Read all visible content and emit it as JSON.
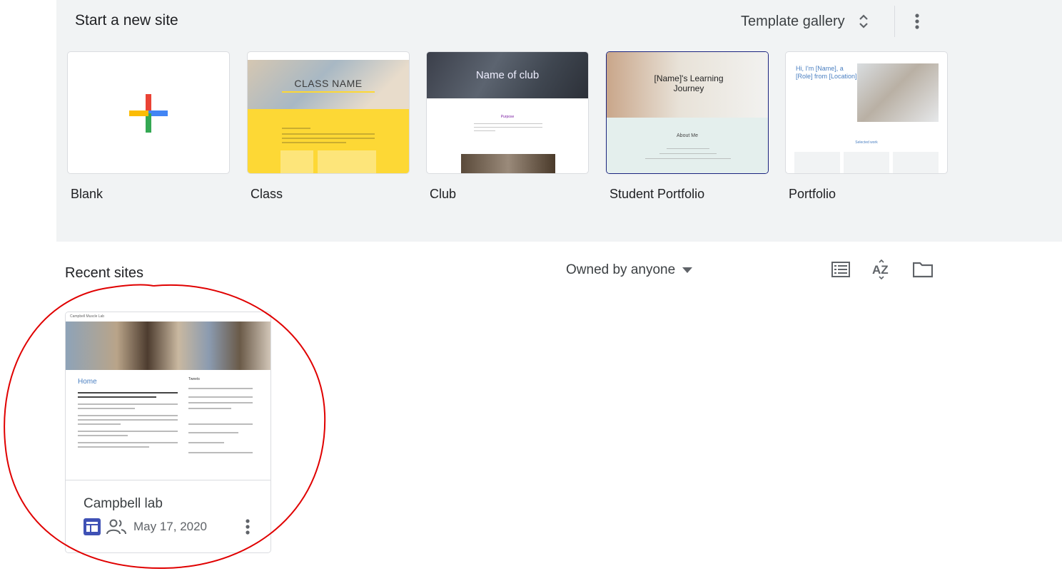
{
  "template_section": {
    "title": "Start a new site",
    "gallery_label": "Template gallery",
    "templates": [
      {
        "label": "Blank"
      },
      {
        "label": "Class",
        "preview_title": "CLASS NAME"
      },
      {
        "label": "Club",
        "preview_title": "Name of club",
        "preview_sub": "Purpose"
      },
      {
        "label": "Student Portfolio",
        "preview_title": "[Name]'s Learning Journey",
        "preview_sub": "About Me"
      },
      {
        "label": "Portfolio",
        "preview_title": "Hi, I'm [Name], a [Role] from [Location].",
        "preview_sub": "Selected work"
      }
    ]
  },
  "recent": {
    "title": "Recent sites",
    "owner_filter": "Owned by anyone",
    "sites": [
      {
        "name": "Campbell lab",
        "date": "May 17, 2020",
        "preview_nav": "Campbell Muscle Lab",
        "preview_home": "Home",
        "preview_tweets": "Tweets"
      }
    ]
  },
  "colors": {
    "band_background": "#f1f3f4",
    "google_red": "#ea4335",
    "google_blue": "#4285f4",
    "google_yellow": "#fbbc04",
    "google_green": "#34a853",
    "sites_icon": "#3f51b5",
    "annotation_circle": "#e00000"
  },
  "icons": [
    "unfold-more-icon",
    "more-vert-icon",
    "dropdown-arrow-icon",
    "list-view-icon",
    "sort-az-icon",
    "folder-icon",
    "sites-icon",
    "shared-people-icon"
  ]
}
